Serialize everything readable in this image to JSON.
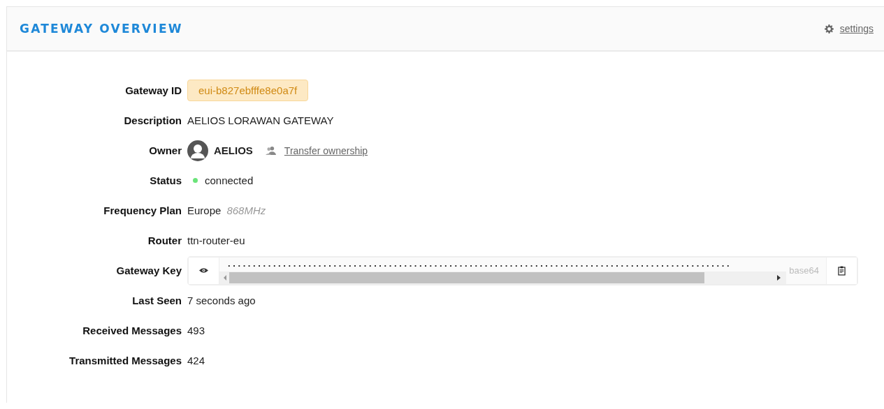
{
  "header": {
    "title": "GATEWAY OVERVIEW",
    "settings_link": "settings"
  },
  "rows": [
    {
      "kind": "badge",
      "label": "Gateway ID",
      "value": "eui-b827ebfffe8e0a7f"
    },
    {
      "kind": "text",
      "label": "Description",
      "value": "AELIOS LORAWAN GATEWAY"
    },
    {
      "kind": "owner",
      "label": "Owner",
      "value": "AELIOS",
      "link": "Transfer ownership"
    },
    {
      "kind": "status",
      "label": "Status",
      "value": "connected",
      "online": true
    },
    {
      "kind": "frequency",
      "label": "Frequency Plan",
      "value": "Europe",
      "detail": "868MHz"
    },
    {
      "kind": "text",
      "label": "Router",
      "value": "ttn-router-eu"
    },
    {
      "kind": "key",
      "label": "Gateway Key",
      "value": "....................................................................................................",
      "encoding": "base64"
    },
    {
      "kind": "text",
      "label": "Last Seen",
      "value": "7 seconds ago"
    },
    {
      "kind": "text",
      "label": "Received Messages",
      "value": "493"
    },
    {
      "kind": "text",
      "label": "Transmitted Messages",
      "value": "424"
    }
  ]
}
